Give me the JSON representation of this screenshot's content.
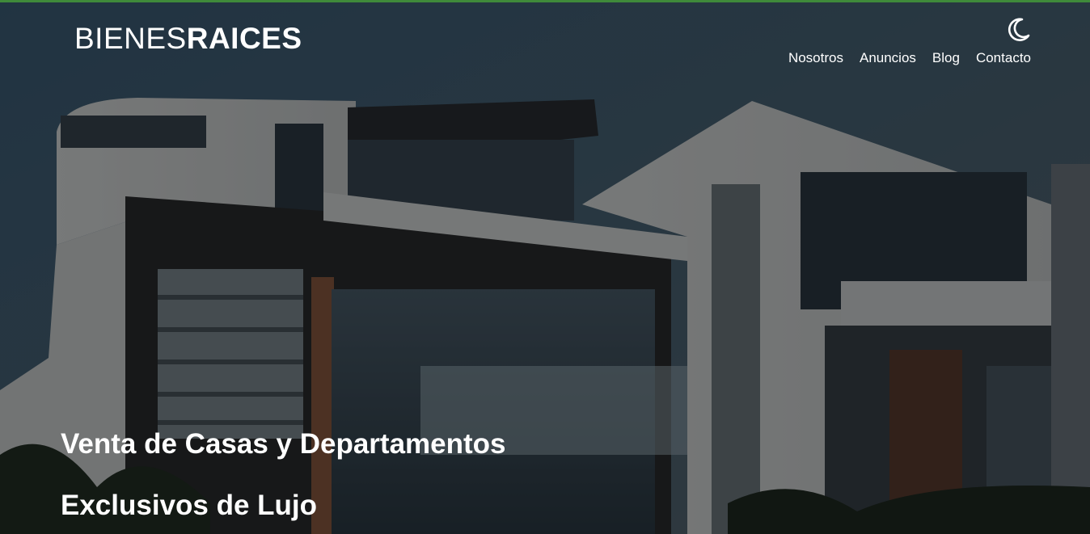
{
  "header": {
    "logo_light": "BIENES",
    "logo_bold": "RAICES",
    "dark_mode_icon": "moon-icon",
    "nav": [
      {
        "label": "Nosotros"
      },
      {
        "label": "Anuncios"
      },
      {
        "label": "Blog"
      },
      {
        "label": "Contacto"
      }
    ]
  },
  "hero": {
    "headline_1": "Venta de Casas y Departamentos",
    "headline_2": "Exclusivos de Lujo"
  },
  "colors": {
    "accent_bar": "#3f8a3a",
    "text": "#ffffff",
    "overlay": "rgba(0,0,0,0.45)"
  }
}
